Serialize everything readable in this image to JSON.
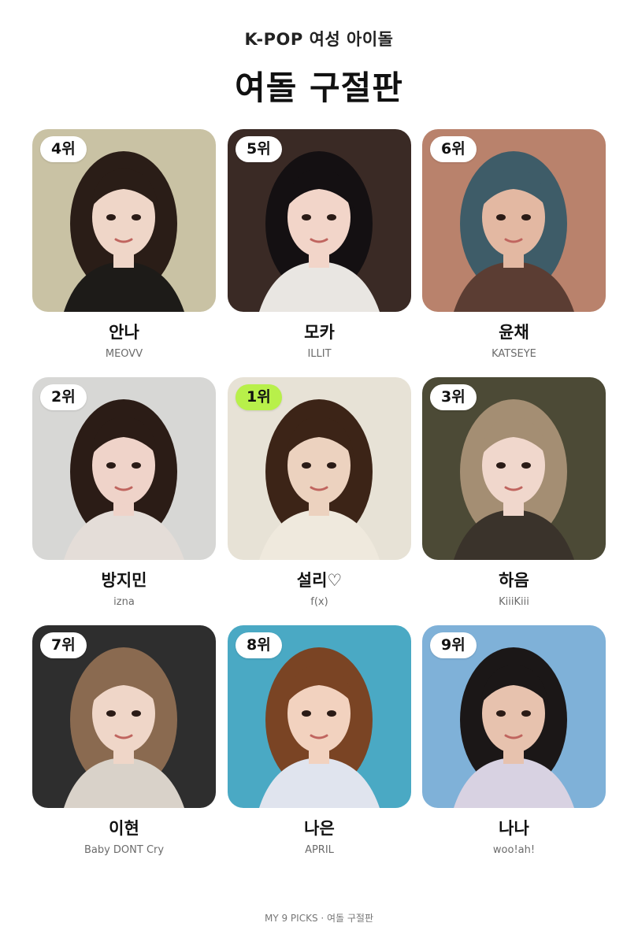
{
  "header": {
    "subtitle": "K-POP 여성 아이돌",
    "title": "여돌 구절판"
  },
  "cards": [
    {
      "rank": "4위",
      "name": "안나",
      "group": "MEOVV",
      "bg": "#c9c2a4",
      "hair": "#2a1d17",
      "skin": "#efd6c8",
      "cloth": "#1d1b18",
      "top": false
    },
    {
      "rank": "5위",
      "name": "모카",
      "group": "ILLIT",
      "bg": "#3a2a25",
      "hair": "#141012",
      "skin": "#f2d5c9",
      "cloth": "#e9e6e2",
      "top": false
    },
    {
      "rank": "6위",
      "name": "윤채",
      "group": "KATSEYE",
      "bg": "#b9826c",
      "hair": "#3e5c68",
      "skin": "#e3b8a2",
      "cloth": "#5b3d33",
      "top": false
    },
    {
      "rank": "2위",
      "name": "방지민",
      "group": "izna",
      "bg": "#d7d7d5",
      "hair": "#2b1c16",
      "skin": "#efd3c9",
      "cloth": "#e4ddd8",
      "top": false
    },
    {
      "rank": "1위",
      "name": "설리♡",
      "group": "f(x)",
      "bg": "#e7e2d6",
      "hair": "#3c2417",
      "skin": "#ecd2bf",
      "cloth": "#efe9dd",
      "top": true
    },
    {
      "rank": "3위",
      "name": "하음",
      "group": "KiiiKiii",
      "bg": "#4c4a36",
      "hair": "#a48e73",
      "skin": "#f0d7cc",
      "cloth": "#3a332b",
      "top": false
    },
    {
      "rank": "7위",
      "name": "이현",
      "group": "Baby DONT Cry",
      "bg": "#2e2e2e",
      "hair": "#8a6a50",
      "skin": "#efd6c8",
      "cloth": "#d9d2c9",
      "top": false
    },
    {
      "rank": "8위",
      "name": "나은",
      "group": "APRIL",
      "bg": "#4aa9c4",
      "hair": "#7a4424",
      "skin": "#f2d2bf",
      "cloth": "#e0e4ee",
      "top": false
    },
    {
      "rank": "9위",
      "name": "나나",
      "group": "woo!ah!",
      "bg": "#7fb1d8",
      "hair": "#1b1717",
      "skin": "#e7c2ae",
      "cloth": "#d8d2e2",
      "top": false
    }
  ],
  "footer": "MY 9 PICKS · 여돌 구절판"
}
